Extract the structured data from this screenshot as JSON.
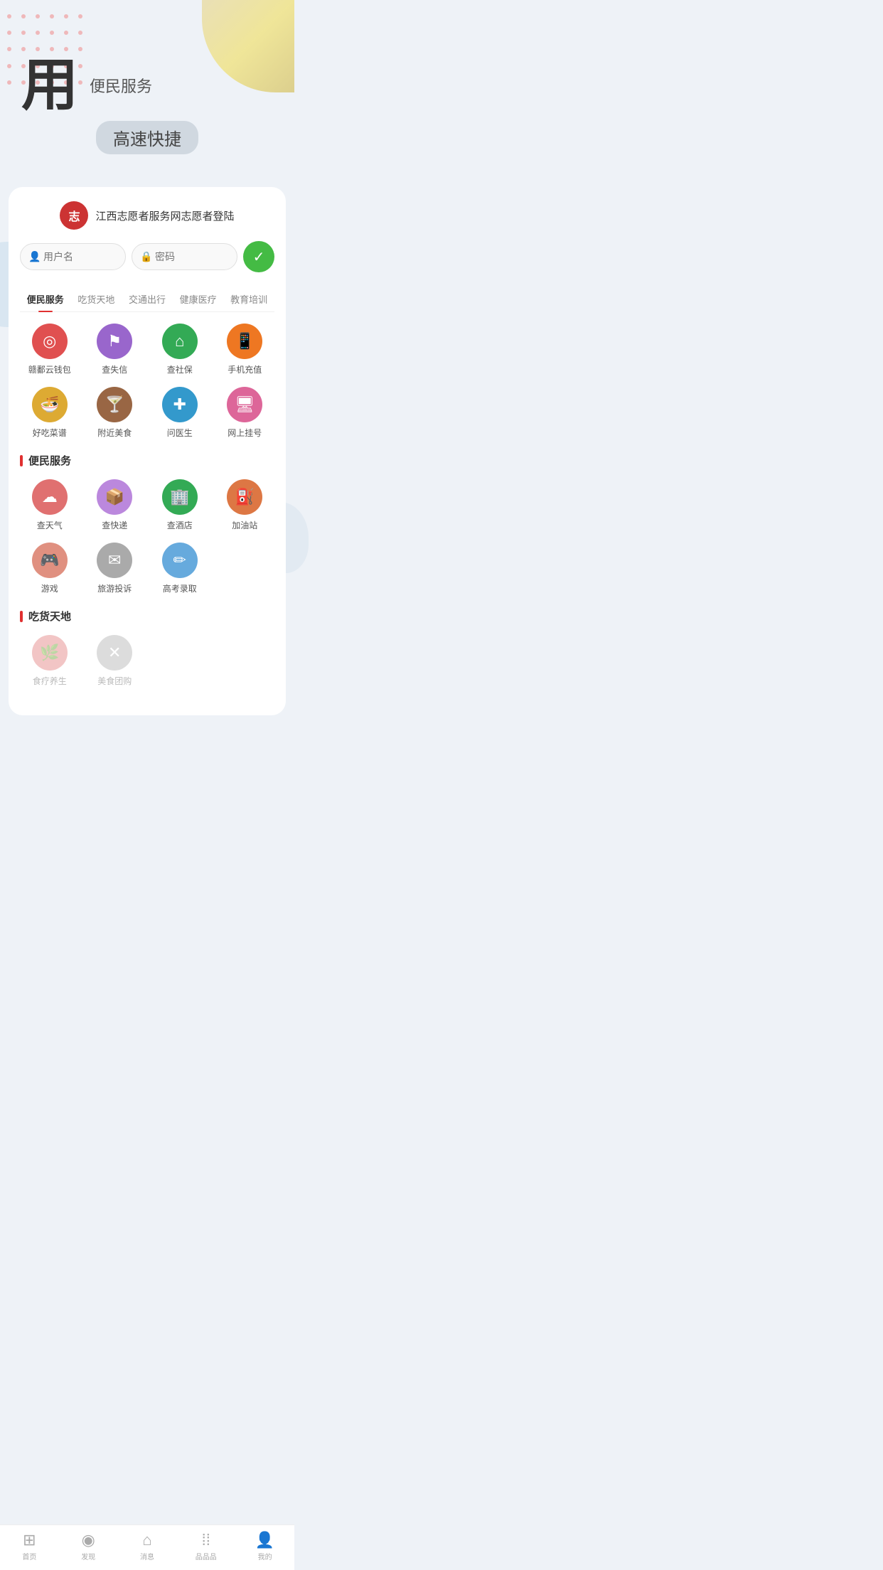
{
  "hero": {
    "char": "用",
    "sub1": "便民服务",
    "sub2": "高速快捷"
  },
  "login": {
    "logo_text": "志",
    "title": "江西志愿者服务网志愿者登陆",
    "username_placeholder": "用户名",
    "password_placeholder": "密码",
    "submit_icon": "✓"
  },
  "tabs": [
    {
      "label": "便民服务",
      "active": true
    },
    {
      "label": "吃货天地",
      "active": false
    },
    {
      "label": "交通出行",
      "active": false
    },
    {
      "label": "健康医疗",
      "active": false
    },
    {
      "label": "教育培训",
      "active": false
    }
  ],
  "quick_services": [
    {
      "label": "赣鄱云钱包",
      "icon": "◎",
      "color": "icon-red"
    },
    {
      "label": "查失信",
      "icon": "⚑",
      "color": "icon-purple"
    },
    {
      "label": "查社保",
      "icon": "⌂",
      "color": "icon-green"
    },
    {
      "label": "手机充值",
      "icon": "📱",
      "color": "icon-orange"
    },
    {
      "label": "好吃菜谱",
      "icon": "🍜",
      "color": "icon-yellow"
    },
    {
      "label": "附近美食",
      "icon": "🍸",
      "color": "icon-brown"
    },
    {
      "label": "问医生",
      "icon": "✚",
      "color": "icon-blue"
    },
    {
      "label": "网上挂号",
      "icon": "🖥",
      "color": "icon-pink"
    }
  ],
  "section1_title": "便民服务",
  "section1_services": [
    {
      "label": "查天气",
      "icon": "☁",
      "color": "icon-salmon"
    },
    {
      "label": "查快递",
      "icon": "📦",
      "color": "icon-light-purple"
    },
    {
      "label": "查酒店",
      "icon": "🏢",
      "color": "icon-green"
    },
    {
      "label": "加油站",
      "icon": "⛽",
      "color": "icon-dark-orange"
    },
    {
      "label": "游戏",
      "icon": "🎮",
      "color": "icon-peach"
    },
    {
      "label": "旅游投诉",
      "icon": "✉",
      "color": "icon-gray"
    },
    {
      "label": "高考录取",
      "icon": "✏",
      "color": "icon-light-blue"
    }
  ],
  "section2_title": "吃货天地",
  "section2_services": [
    {
      "label": "食疗养生",
      "icon": "🌿",
      "color": "icon-salmon",
      "faded": true
    },
    {
      "label": "美食团购",
      "icon": "✕",
      "color": "icon-gray",
      "faded": true
    }
  ],
  "bottom_nav": [
    {
      "label": "首页",
      "icon": "⊞"
    },
    {
      "label": "发现",
      "icon": "◉"
    },
    {
      "label": "消息",
      "icon": "⌂"
    },
    {
      "label": "品品品",
      "icon": "⁞⁞"
    },
    {
      "label": "我的",
      "icon": "👤"
    }
  ]
}
